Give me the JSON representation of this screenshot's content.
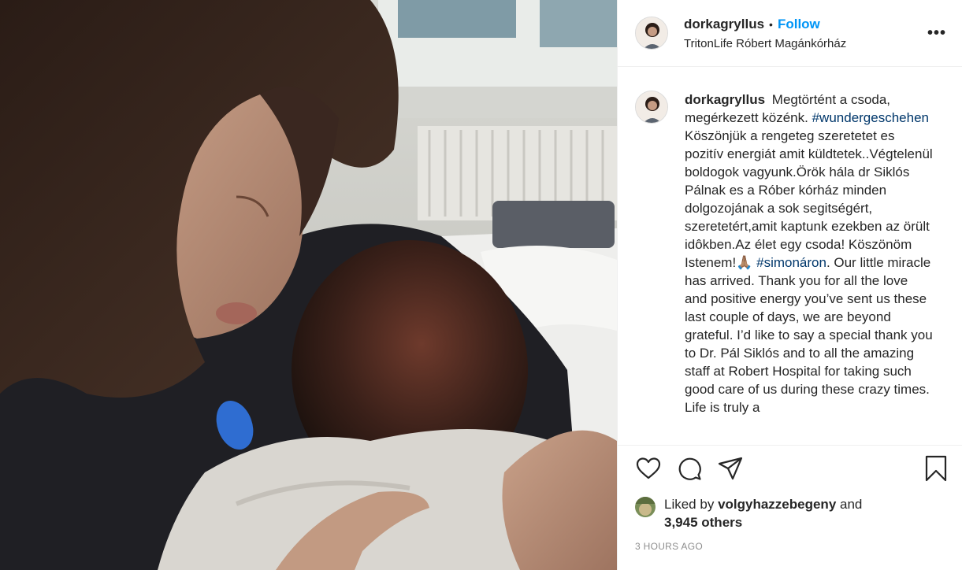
{
  "photo": {
    "alt_subject": "woman-holding-newborn-photo"
  },
  "header": {
    "username": "dorkagryllus",
    "separator": "•",
    "follow_label": "Follow",
    "location": "TritonLife Róbert Magánkórház",
    "more_label": "•••"
  },
  "caption": {
    "username": "dorkagryllus",
    "text_1": "Megtörtént a csoda, megérkezett közénk.",
    "hashtag_1": "#wundergeschehen",
    "text_2": "Köszönjük a rengeteg szeretetet es pozitív energiát amit küldtetek..Végtelenül boldogok vagyunk.Örök hála dr Siklós Pálnak es a Róber kórház minden dolgozojának a sok segitségért, szeretetért,amit kaptunk ezekben az örült idôkben.Az élet egy csoda! Köszönöm Istenem!🙏🏽",
    "hashtag_2": "#simonáron",
    "text_3": ". Our little miracle has arrived. Thank you for all the love and positive energy you’ve sent us these last couple of days, we are beyond grateful. I’d like to say a special thank you to Dr. Pál Siklós and to all the amazing staff at Robert Hospital for taking such good care of us during these crazy times. Life is truly a"
  },
  "actions": {
    "like_icon": "heart-icon",
    "comment_icon": "comment-icon",
    "share_icon": "paper-plane-icon",
    "save_icon": "bookmark-icon"
  },
  "likes": {
    "prefix": "Liked by",
    "user": "volgyhazzebegeny",
    "and": "and",
    "count": "3,945 others"
  },
  "timestamp": "3 HOURS AGO",
  "colors": {
    "accent": "#0095f6",
    "hashtag": "#00376b",
    "muted": "#8e8e8e",
    "border": "#efefef"
  }
}
